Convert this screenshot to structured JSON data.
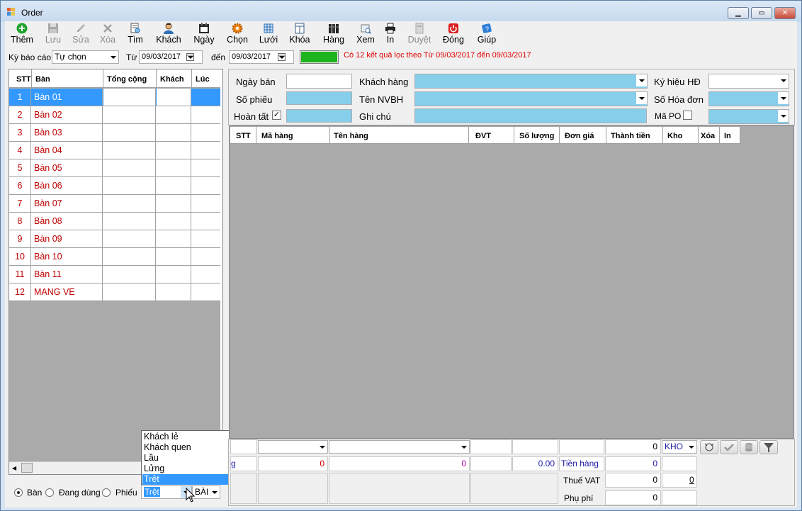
{
  "window": {
    "title": "Order",
    "min_label": "▁",
    "max_label": "▭",
    "close_label": "✕"
  },
  "toolbar": {
    "items": [
      {
        "label": "Thêm",
        "icon": "plus-circle-icon",
        "enabled": true
      },
      {
        "label": "Lưu",
        "icon": "floppy-disk-icon",
        "enabled": false
      },
      {
        "label": "Sửa",
        "icon": "pencil-icon",
        "enabled": false
      },
      {
        "label": "Xóa",
        "icon": "x-delete-icon",
        "enabled": false
      },
      {
        "label": "Tìm",
        "icon": "find-document-icon",
        "enabled": true
      },
      {
        "label": "Khách",
        "icon": "customer-icon",
        "enabled": true
      },
      {
        "label": "Ngày",
        "icon": "calendar-icon",
        "enabled": true
      },
      {
        "label": "Chọn",
        "icon": "gear-icon",
        "enabled": true
      },
      {
        "label": "Lưới",
        "icon": "grid-icon",
        "enabled": true
      },
      {
        "label": "Khóa",
        "icon": "lock-icon",
        "enabled": true
      },
      {
        "label": "Hàng",
        "icon": "books-icon",
        "enabled": true
      },
      {
        "label": "Xem",
        "icon": "preview-icon",
        "enabled": true
      },
      {
        "label": "In",
        "icon": "printer-icon",
        "enabled": true
      },
      {
        "label": "Duyệt",
        "icon": "approve-icon",
        "enabled": false
      },
      {
        "label": "Đóng",
        "icon": "power-icon",
        "enabled": true
      },
      {
        "label": "Giúp",
        "icon": "help-book-icon",
        "enabled": true
      }
    ]
  },
  "filter": {
    "period_label": "Kỳ báo cáo",
    "period_value": "Tự chọn",
    "from_label": "Từ",
    "from_date": "09/03/2017",
    "to_label": "đến",
    "to_date": "09/03/2017",
    "result_text": "Có 12 kết quả lọc theo Từ 09/03/2017 đến 09/03/2017",
    "result_color": "#e00000",
    "progress_color": "#1db41d",
    "progress_value": 1.0
  },
  "left_grid": {
    "columns": [
      "STT",
      "Bàn",
      "Tổng cộng",
      "Khách",
      "Lúc"
    ],
    "rows": [
      {
        "stt": "1",
        "ban": "Bàn 01"
      },
      {
        "stt": "2",
        "ban": "Bàn 02"
      },
      {
        "stt": "3",
        "ban": "Bàn 03"
      },
      {
        "stt": "4",
        "ban": "Bàn 04"
      },
      {
        "stt": "5",
        "ban": "Bàn 05"
      },
      {
        "stt": "6",
        "ban": "Bàn 06"
      },
      {
        "stt": "7",
        "ban": "Bàn 07"
      },
      {
        "stt": "8",
        "ban": "Bàn 08"
      },
      {
        "stt": "9",
        "ban": "Bàn 09"
      },
      {
        "stt": "10",
        "ban": "Bàn 10"
      },
      {
        "stt": "11",
        "ban": "Bàn 11"
      },
      {
        "stt": "12",
        "ban": "MANG VE"
      }
    ],
    "selected_row": 0
  },
  "bottom_left": {
    "radio_ban": "Bàn",
    "radio_dang_dung": "Đang dùng",
    "radio_phieu": "Phiếu",
    "selected_radio": "Bàn",
    "area_combo_value": "Trệt",
    "second_combo_value": "BÀI"
  },
  "area_dropdown": {
    "options": [
      "Khách lẻ",
      "Khách quen",
      "Lầu",
      "Lửng",
      "Trệt"
    ],
    "selected": "Trệt"
  },
  "order_form": {
    "ngay_ban_label": "Ngày bán",
    "so_phieu_label": "Số phiếu",
    "hoan_tat_label": "Hoàn tất",
    "hoan_tat_checked": true,
    "khach_hang_label": "Khách hàng",
    "ten_nvbh_label": "Tên NVBH",
    "ghi_chu_label": "Ghi chú",
    "ky_hieu_hd_label": "Ký hiệu HĐ",
    "so_hoa_don_label": "Số Hóa đơn",
    "ma_po_label": "Mã PO",
    "ma_po_checked": false
  },
  "detail_grid": {
    "columns": [
      "STT",
      "Mã hàng",
      "Tên hàng",
      "ĐVT",
      "Số lượng",
      "Đơn giá",
      "Thành tiền",
      "Kho",
      "Xóa",
      "In"
    ]
  },
  "footer": {
    "row1_value": "0",
    "kho_value": "KHO",
    "row2_prefix": "g",
    "row2_red_value": "0",
    "row2_purple_value": "0",
    "tien_hang_value": "0.00",
    "tien_hang_label": "Tiền hàng",
    "tien_hang_total": "0",
    "thue_vat_label": "Thuế VAT",
    "thue_vat_value": "0",
    "thue_vat_rate": "0",
    "phu_phi_label": "Phụ phí",
    "phu_phi_value": "0"
  }
}
